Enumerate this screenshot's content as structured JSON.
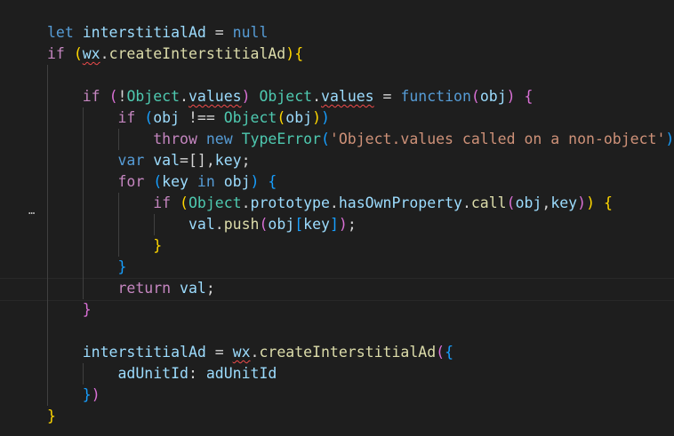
{
  "editor": {
    "fold_indicator": "…",
    "code": {
      "l1": {
        "kw_let": "let",
        "name": "interstitialAd",
        "eq": " = ",
        "null_kw": "null"
      },
      "l2": {
        "kw_if": "if",
        "open": "(",
        "obj": "wx",
        "dot": ".",
        "method": "createInterstitialAd",
        "close": ")",
        "brace": "{"
      },
      "l4": {
        "kw_if": "if",
        "open": "(",
        "bang": "!",
        "obj": "Object",
        "dot": ".",
        "prop": "values",
        "close": ")",
        "obj2": "Object",
        "dot2": ".",
        "prop2": "values",
        "eq": " = ",
        "kw_function": "function",
        "popen": "(",
        "param": "obj",
        "pclose": ")",
        "brace": "{"
      },
      "l5": {
        "kw_if": "if",
        "open": "(",
        "var": "obj",
        "op": " !== ",
        "cls": "Object",
        "popen": "(",
        "arg": "obj",
        "pclose": ")",
        "close": ")"
      },
      "l6": {
        "kw_throw": "throw",
        "kw_new": "new",
        "cls": "TypeError",
        "popen": "(",
        "str": "'Object.values called on a non-object'",
        "pclose": ")",
        "semi": ";"
      },
      "l7": {
        "kw_var": "var",
        "v1": "val",
        "mid": "=[],",
        "v2": "key",
        "semi": ";"
      },
      "l8": {
        "kw_for": "for",
        "open": "(",
        "v1": "key",
        "kw_in": "in",
        "v2": "obj",
        "close": ")",
        "brace": "{"
      },
      "l9": {
        "kw_if": "if",
        "open": "(",
        "obj": "Object",
        "d1": ".",
        "p1": "prototype",
        "d2": ".",
        "m1": "hasOwnProperty",
        "d3": ".",
        "m2": "call",
        "popen": "(",
        "a1": "obj",
        "comma": ",",
        "a2": "key",
        "pclose": ")",
        "close": ")",
        "brace": "{"
      },
      "l10": {
        "v": "val",
        "dot": ".",
        "m": "push",
        "popen": "(",
        "obj": "obj",
        "bopen": "[",
        "key": "key",
        "bclose": "]",
        "pclose": ")",
        "semi": ";"
      },
      "l11": {
        "brace": "}"
      },
      "l12": {
        "brace": "}"
      },
      "l13": {
        "kw_return": "return",
        "v": "val",
        "semi": ";"
      },
      "l14": {
        "brace": "}"
      },
      "l16": {
        "name": "interstitialAd",
        "eq": " = ",
        "obj": "wx",
        "dot": ".",
        "method": "createInterstitialAd",
        "popen": "(",
        "bopen": "{"
      },
      "l17": {
        "prop": "adUnitId",
        "colon": ": ",
        "val": "adUnitId"
      },
      "l18": {
        "bclose": "}",
        "pclose": ")"
      },
      "l19": {
        "brace": "}"
      }
    }
  }
}
